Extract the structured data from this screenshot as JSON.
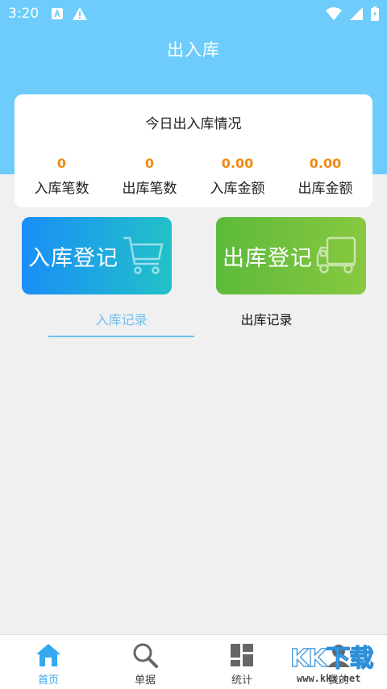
{
  "status_bar": {
    "time": "3:20",
    "icons": [
      "a-box-icon",
      "warning-icon",
      "wifi-icon",
      "signal-icon",
      "battery-icon"
    ]
  },
  "header": {
    "title": "出入库"
  },
  "summary": {
    "title": "今日出入库情况",
    "stats": [
      {
        "value": "0",
        "label": "入库笔数"
      },
      {
        "value": "0",
        "label": "出库笔数"
      },
      {
        "value": "0.00",
        "label": "入库金额"
      },
      {
        "value": "0.00",
        "label": "出库金额"
      }
    ]
  },
  "actions": {
    "stock_in": {
      "label": "入库登记",
      "icon": "cart-icon"
    },
    "stock_out": {
      "label": "出库登记",
      "icon": "truck-icon"
    }
  },
  "tabs": [
    {
      "label": "入库记录",
      "active": true
    },
    {
      "label": "出库记录",
      "active": false
    }
  ],
  "bottom_nav": [
    {
      "label": "首页",
      "icon": "home-icon",
      "active": true
    },
    {
      "label": "单据",
      "icon": "search-icon",
      "active": false
    },
    {
      "label": "统计",
      "icon": "stats-icon",
      "active": false
    },
    {
      "label": "我的",
      "icon": "profile-icon",
      "active": false
    }
  ],
  "watermark": {
    "logo": "KK下载",
    "url": "www.kkx.net"
  },
  "colors": {
    "header": "#6dccfb",
    "accent_orange": "#f28a12",
    "tab_active": "#6dc0ef",
    "nav_active": "#36a8ef"
  }
}
